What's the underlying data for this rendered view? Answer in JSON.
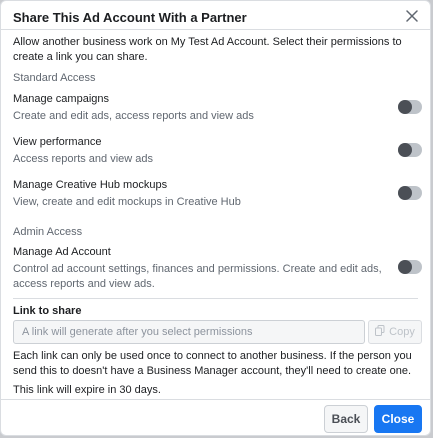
{
  "dialog": {
    "title": "Share This Ad Account With a Partner",
    "description": "Allow another business work on My Test Ad Account. Select their permissions to create a link you can share."
  },
  "standard_access": {
    "label": "Standard Access",
    "items": [
      {
        "title": "Manage campaigns",
        "subtitle": "Create and edit ads, access reports and view ads",
        "enabled": false
      },
      {
        "title": "View performance",
        "subtitle": "Access reports and view ads",
        "enabled": false
      },
      {
        "title": "Manage Creative Hub mockups",
        "subtitle": "View, create and edit mockups in Creative Hub",
        "enabled": false
      }
    ]
  },
  "admin_access": {
    "label": "Admin Access",
    "items": [
      {
        "title": "Manage Ad Account",
        "subtitle": "Control ad account settings, finances and permissions. Create and edit ads, access reports and view ads.",
        "enabled": false
      }
    ]
  },
  "link": {
    "label": "Link to share",
    "placeholder": "A link will generate after you select permissions",
    "value": "",
    "copy_label": "Copy",
    "help": "Each link can only be used once to connect to another business. If the person you send this to doesn't have a Business Manager account, they'll need to create one.",
    "expire": "This link will expire in 30 days."
  },
  "footer": {
    "back_label": "Back",
    "close_label": "Close"
  },
  "colors": {
    "primary": "#1877f2",
    "toggle_track": "#bec3c9",
    "toggle_knob": "#4b4f56",
    "secondary_text": "#606770"
  },
  "icons": {
    "close": "close-icon",
    "copy": "copy-icon"
  }
}
